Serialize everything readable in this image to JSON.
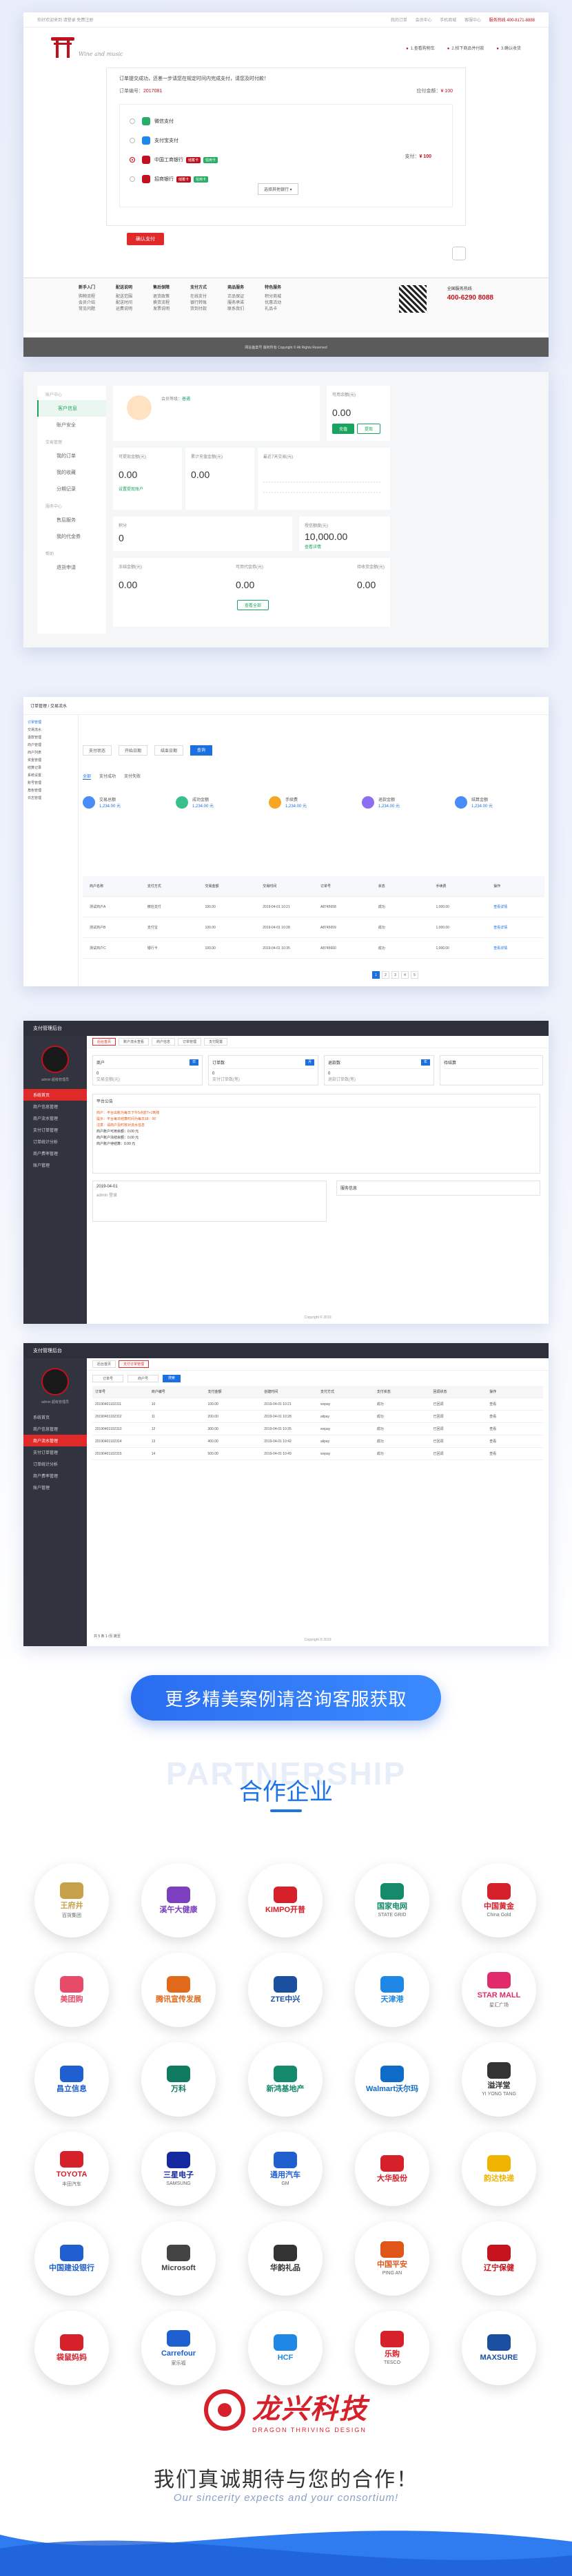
{
  "checkout": {
    "topbar_left": "你好欢迎来到  请登录  免费注册",
    "topbar_right": [
      "我的订单",
      "会员中心",
      "手机商城",
      "客服中心",
      "服务热线 400-8171-8888"
    ],
    "logo_script": "Wine and music",
    "steps": [
      "1.查看购物车",
      "2.拍下商品并付款",
      "3.确认收货"
    ],
    "note": "订单提交成功，还差一步请您在规定时间内完成支付，请您及时付款！",
    "order_label": "订单编号：",
    "order_no": "2017081",
    "pay_label": "应付金额：",
    "pay_value": "¥ 100",
    "banks": [
      {
        "name": "微信支付",
        "color": "#2aae67"
      },
      {
        "name": "支付宝支付",
        "color": "#1f87e6"
      },
      {
        "name": "中国工商银行",
        "color": "#c0121e"
      },
      {
        "name": "招商银行",
        "color": "#c0121e"
      }
    ],
    "tags": [
      "储蓄卡",
      "信用卡"
    ],
    "more_btn": "选择其他银行 ▾",
    "amount_label": "支付：",
    "amount_value": "¥ 100",
    "pay_button": "确认支付",
    "footer_cols": [
      {
        "head": "新手入门",
        "items": [
          "购物流程",
          "会员介绍",
          "常见问题"
        ]
      },
      {
        "head": "配送说明",
        "items": [
          "配送范围",
          "配送时间",
          "运费说明"
        ]
      },
      {
        "head": "售后保障",
        "items": [
          "退货政策",
          "换货流程",
          "发票说明"
        ]
      },
      {
        "head": "支付方式",
        "items": [
          "在线支付",
          "银行转账",
          "货到付款"
        ]
      },
      {
        "head": "商品服务",
        "items": [
          "正品保证",
          "服务承诺",
          "联系我们"
        ]
      },
      {
        "head": "特色服务",
        "items": [
          "积分商城",
          "优惠活动",
          "礼品卡"
        ]
      }
    ],
    "tel_label": "全国服务热线",
    "tel_value": "400-6290 8088",
    "copyright": "网站备案号 版权所有 Copyright © All Rights Reserved"
  },
  "usercenter": {
    "menu": [
      {
        "group": "账户中心",
        "items": [
          "客户信息",
          "账户安全"
        ]
      },
      {
        "group": "交易管理",
        "items": [
          "我的订单",
          "我的收藏",
          "分期记录"
        ]
      },
      {
        "group": "服务中心",
        "items": [
          "售后服务",
          "我的代金券"
        ]
      },
      {
        "group": "帮助",
        "items": [
          "退货申请"
        ]
      }
    ],
    "active": "客户信息",
    "user_label": "会员等级：",
    "user_level": "普通",
    "balance_label": "可用余额(元)",
    "balance_value": "0.00",
    "recharge": "充值",
    "withdraw": "提现",
    "boxes": [
      {
        "label": "可提现金额(元)",
        "value": "0.00",
        "link": "设置提现账户"
      },
      {
        "label": "累计充值金额(元)",
        "value": "0.00"
      },
      {
        "label": "最近7天交易(元)",
        "value": ""
      },
      {
        "label": "积分",
        "value": "0"
      },
      {
        "label": "授信额度(元)",
        "value": "10,000.00",
        "link": "查看详情"
      },
      {
        "label": "冻结金额(元)",
        "value": "0.00"
      },
      {
        "label": "可用代金券(元)",
        "value": "0.00"
      },
      {
        "label": "待收货金额(元)",
        "value": "0.00"
      }
    ],
    "detail_button": "查看全部"
  },
  "admin_table": {
    "topbar": "订单管理 / 交易流水",
    "side": [
      "订单管理",
      "交易流水",
      "退款管理",
      "商户管理",
      "商户列表",
      "资金管理",
      "结算记录",
      "系统设置",
      "账号管理",
      "角色管理",
      "日志管理"
    ],
    "filters": [
      "支付状态",
      "开始日期",
      "结束日期",
      "查询"
    ],
    "tabs": [
      "全部",
      "支付成功",
      "支付失败"
    ],
    "stats": [
      {
        "label": "交易总额",
        "value": "1,234.00 元",
        "color": "#4a8cf7"
      },
      {
        "label": "成功金额",
        "value": "1,234.00 元",
        "color": "#38c08c"
      },
      {
        "label": "手续费",
        "value": "1,234.00 元",
        "color": "#f5a623"
      },
      {
        "label": "退款金额",
        "value": "1,234.00 元",
        "color": "#8c6ff0"
      },
      {
        "label": "结算金额",
        "value": "1,234.00 元",
        "color": "#4a8cf7"
      }
    ],
    "headers": [
      "商户名称",
      "支付方式",
      "交易金额",
      "交易时间",
      "订单号",
      "状态",
      "手续费",
      "操作"
    ],
    "rows": [
      [
        "测试商户A",
        "微信支付",
        "100.00",
        "2019-04-01 10:21",
        "A8745658",
        "成功",
        "1,000.00",
        "查看详情"
      ],
      [
        "测试商户B",
        "支付宝",
        "100.00",
        "2019-04-01 10:28",
        "A8745659",
        "成功",
        "1,000.00",
        "查看详情"
      ],
      [
        "测试商户C",
        "银行卡",
        "100.00",
        "2019-04-01 10:35",
        "A8745660",
        "成功",
        "1,000.00",
        "查看详情"
      ]
    ],
    "pager": [
      "1",
      "2",
      "3",
      "4",
      "5"
    ]
  },
  "dark_admin_1": {
    "title": "支付管理后台",
    "user": "admin 超级管理员",
    "menu": [
      "系统首页",
      "商户信息管理",
      "商户流水管理",
      "支付订单管理",
      "订单统计分析",
      "商户费率管理",
      "账户管理"
    ],
    "active": "系统首页",
    "tabs": [
      "后台首页",
      "账户流水查看",
      "商户信息",
      "订单管理",
      "支付配置"
    ],
    "cards": [
      {
        "title": "商户",
        "badge": "日",
        "value": "0",
        "sub": "交易金额(元)"
      },
      {
        "title": "订单数",
        "badge": "月",
        "value": "0",
        "sub": "支付订单数(笔)"
      },
      {
        "title": "退款数",
        "badge": "年",
        "value": "0",
        "sub": "退款订单数(笔)"
      },
      {
        "title": "待结算",
        "badge": "",
        "value": "",
        "sub": ""
      }
    ],
    "notice_title": "平台公告",
    "notice_lines": [
      "商户：平台出账为每日下午5点前T+1到账",
      "提示：平台每日结算时间为每日18：00",
      "注意：请商户及时核对流水信息",
      "商户账户可用余额：0.00 元",
      "商户账户冻结余额：0.00 元",
      "商户账户待结算：0.00 元"
    ],
    "log_date": "2019-04-01",
    "log_text": "admin 登录",
    "side_title": "服务信息",
    "copyright": "Copyright © 2019"
  },
  "dark_admin_2": {
    "title": "支付管理后台",
    "menu": [
      "系统首页",
      "商户信息管理",
      "商户流水管理",
      "支付订单管理",
      "订单统计分析",
      "商户费率管理",
      "账户管理"
    ],
    "active": "支付订单管理",
    "tabs": [
      "后台首页",
      "支付订单管理"
    ],
    "filters": [
      "订单号",
      "商户号",
      "搜索"
    ],
    "headers": [
      "订单号",
      "商户编号",
      "支付金额",
      "创建时间",
      "支付方式",
      "支付状态",
      "回调状态",
      "操作"
    ],
    "rows": [
      [
        "20190401102311",
        "10",
        "100.00",
        "2019-04-01 10:21",
        "wxpay",
        "成功",
        "已回调",
        "查看"
      ],
      [
        "20190401102312",
        "11",
        "200.00",
        "2019-04-01 10:28",
        "alipay",
        "成功",
        "已回调",
        "查看"
      ],
      [
        "20190401102313",
        "12",
        "300.00",
        "2019-04-01 10:35",
        "wxpay",
        "成功",
        "已回调",
        "查看"
      ],
      [
        "20190401102314",
        "13",
        "400.00",
        "2019-04-01 10:42",
        "alipay",
        "成功",
        "已回调",
        "查看"
      ],
      [
        "20190401102315",
        "14",
        "500.00",
        "2019-04-01 10:49",
        "wxpay",
        "成功",
        "已回调",
        "查看"
      ]
    ],
    "pager": "共 5 条  1  /页  跳至",
    "copyright": "Copyright © 2019"
  },
  "cta_text": "更多精美案例请咨询客服获取",
  "partnership_bg": "PARTNERSHIP",
  "partnership_title": "合作企业",
  "partners": [
    {
      "name": "王府井",
      "sub": "百货集团",
      "color": "#c7a14a"
    },
    {
      "name": "溪午大健康",
      "sub": "",
      "color": "#7b3fbf"
    },
    {
      "name": "KIMPO开普",
      "sub": "",
      "color": "#d6202a"
    },
    {
      "name": "国家电网",
      "sub": "STATE GRID",
      "color": "#148a6b"
    },
    {
      "name": "中国黄金",
      "sub": "China Gold",
      "color": "#d6202a"
    },
    {
      "name": "美团购",
      "sub": "",
      "color": "#e84a6a"
    },
    {
      "name": "腾讯宣传发展",
      "sub": "",
      "color": "#e06a1a"
    },
    {
      "name": "ZTE中兴",
      "sub": "",
      "color": "#1b4fa0"
    },
    {
      "name": "天津港",
      "sub": "",
      "color": "#1f87e6"
    },
    {
      "name": "STAR MALL",
      "sub": "星汇广场",
      "color": "#e02a6a"
    },
    {
      "name": "昌立信息",
      "sub": "",
      "color": "#1f5fd0"
    },
    {
      "name": "万科",
      "sub": "",
      "color": "#0e7a5f"
    },
    {
      "name": "新鸿基地产",
      "sub": "",
      "color": "#138a6b"
    },
    {
      "name": "Walmart沃尔玛",
      "sub": "",
      "color": "#0e6bc7"
    },
    {
      "name": "溢洋堂",
      "sub": "YI YONG TANG",
      "color": "#333333"
    },
    {
      "name": "TOYOTA",
      "sub": "丰田汽车",
      "color": "#d6202a"
    },
    {
      "name": "三星电子",
      "sub": "SAMSUNG",
      "color": "#1428a0"
    },
    {
      "name": "通用汽车",
      "sub": "GM",
      "color": "#1f5fd0"
    },
    {
      "name": "大华股份",
      "sub": "",
      "color": "#d6202a"
    },
    {
      "name": "韵达快递",
      "sub": "",
      "color": "#f0b400"
    },
    {
      "name": "中国建设银行",
      "sub": "",
      "color": "#1f5fd0"
    },
    {
      "name": "Microsoft",
      "sub": "",
      "color": "#444444"
    },
    {
      "name": "华韵礼品",
      "sub": "",
      "color": "#333333"
    },
    {
      "name": "中国平安",
      "sub": "PING AN",
      "color": "#e0561a"
    },
    {
      "name": "辽宁保健",
      "sub": "",
      "color": "#c7131d"
    },
    {
      "name": "袋鼠妈妈",
      "sub": "",
      "color": "#d6202a"
    },
    {
      "name": "Carrefour",
      "sub": "家乐福",
      "color": "#1f5fd0"
    },
    {
      "name": "HCF",
      "sub": "",
      "color": "#1f87e6"
    },
    {
      "name": "乐购",
      "sub": "TESCO",
      "color": "#d6202a"
    },
    {
      "name": "MAXSURE",
      "sub": "",
      "color": "#1b4fa0"
    }
  ],
  "brand_cn": "龙兴科技",
  "brand_en": "DRAGON THRIVING DESIGN",
  "slogan": "我们真诚期待与您的合作！",
  "slogan_en": "Our sincerity expects and your consortium!"
}
